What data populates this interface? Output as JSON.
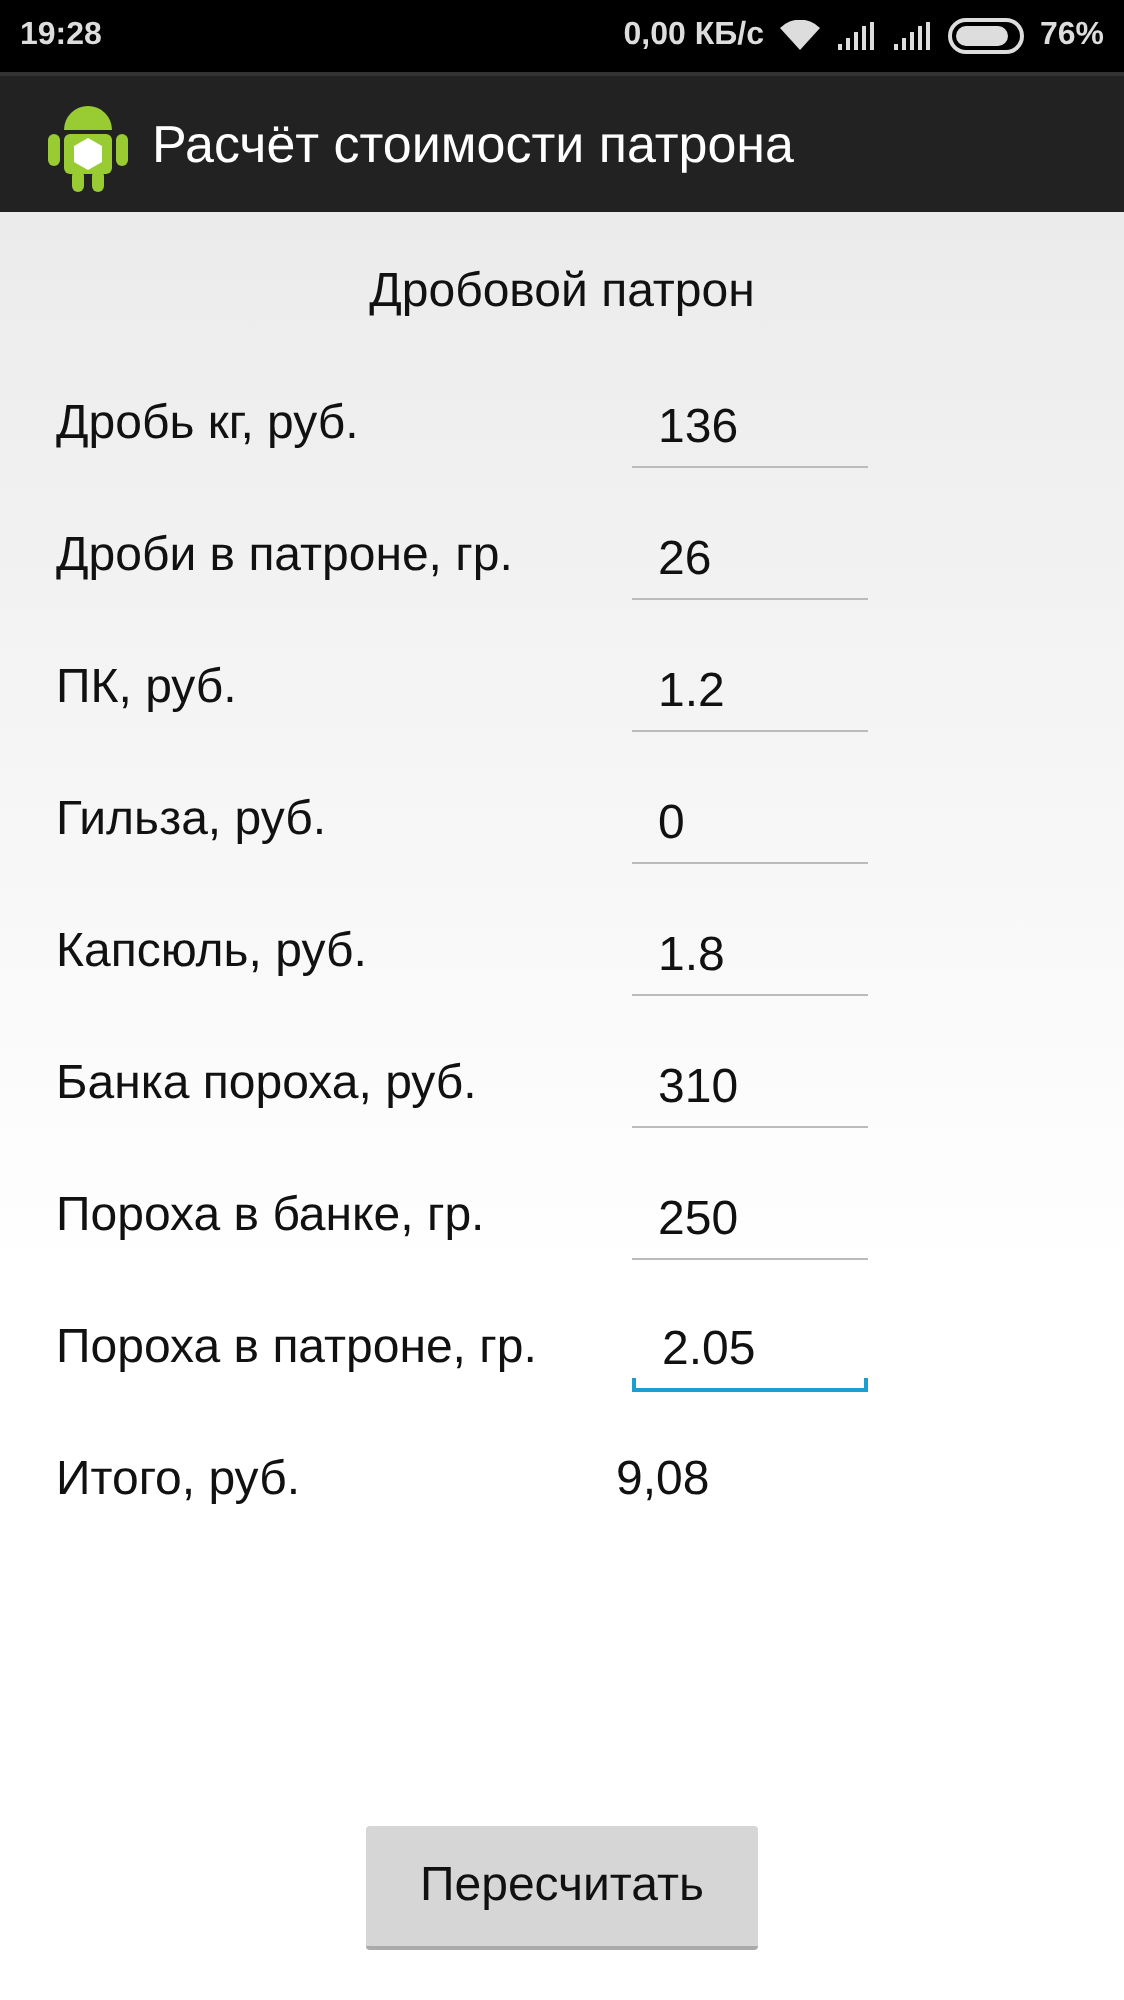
{
  "status_bar": {
    "time": "19:28",
    "speed": "0,00 КБ/с",
    "battery": "76%"
  },
  "app_bar": {
    "title": "Расчёт стоимости патрона"
  },
  "heading": "Дробовой патрон",
  "fields": [
    {
      "label": "Дробь кг, руб.",
      "value": "136",
      "focused": false
    },
    {
      "label": "Дроби в патроне, гр.",
      "value": "26",
      "focused": false
    },
    {
      "label": "ПК, руб.",
      "value": "1.2",
      "focused": false
    },
    {
      "label": "Гильза, руб.",
      "value": "0",
      "focused": false
    },
    {
      "label": "Капсюль, руб.",
      "value": "1.8",
      "focused": false
    },
    {
      "label": "Банка пороха, руб.",
      "value": "310",
      "focused": false
    },
    {
      "label": "Пороха в банке, гр.",
      "value": "250",
      "focused": false
    },
    {
      "label": "Пороха в патроне, гр.",
      "value": "2.05",
      "focused": true
    }
  ],
  "total": {
    "label": "Итого, руб.",
    "value": "9,08"
  },
  "button": "Пересчитать"
}
